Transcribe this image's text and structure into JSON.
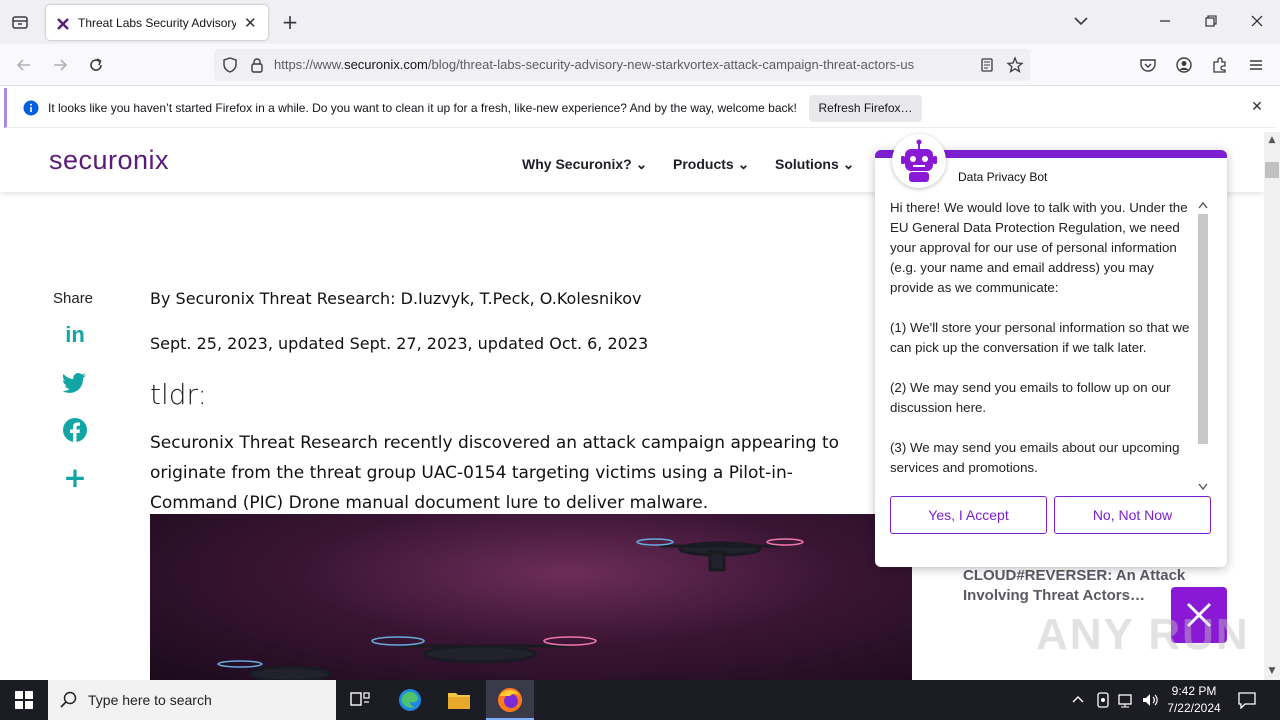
{
  "browser": {
    "tab_title": "Threat Labs Security Advisory: N",
    "url_prefix": "https://www.",
    "url_domain": "securonix.com",
    "url_path": "/blog/threat-labs-security-advisory-new-starkvortex-attack-campaign-threat-actors-us",
    "notification": "It looks like you haven’t started Firefox in a while. Do you want to clean it up for a fresh, like-new experience? And by the way, welcome back!",
    "refresh_button": "Refresh Firefox…"
  },
  "site": {
    "logo": "securonix",
    "menu": [
      "Why Securonix?",
      "Products",
      "Solutions"
    ]
  },
  "article": {
    "share_label": "Share",
    "byline": "By Securonix Threat Research: D.Iuzvyk, T.Peck, O.Kolesnikov",
    "dates": "Sept. 25, 2023, updated Sept. 27, 2023, updated Oct. 6, 2023",
    "tldr": "tldr:",
    "summary": "Securonix Threat Research recently discovered an attack campaign appearing to originate from the threat group UAC-0154 targeting victims using a Pilot-in-Command (PIC) Drone manual document lure to deliver malware."
  },
  "related": {
    "title": "CLOUD#REVERSER: An Attack Involving Threat Actors…"
  },
  "chat": {
    "bot_name": "Data Privacy Bot",
    "paragraphs": [
      "Hi there! We would love to talk with you. Under the EU General Data Protection Regulation, we need your approval for our use of personal information (e.g. your name and email address) you may provide as we communicate:",
      "(1) We'll store your personal information so that we can pick up the conversation if we talk later.",
      "(2) We may send you emails to follow up on our discussion here.",
      "(3) We may send you emails about our upcoming services and promotions."
    ],
    "accept": "Yes, I Accept",
    "decline": "No, Not Now"
  },
  "watermark": "ANY RUN",
  "taskbar": {
    "search_placeholder": "Type here to search",
    "time": "9:42 PM",
    "date": "7/22/2024"
  },
  "colors": {
    "accent": "#7b1fd1",
    "logo": "#5b1a7a",
    "share": "#12a5a5"
  }
}
